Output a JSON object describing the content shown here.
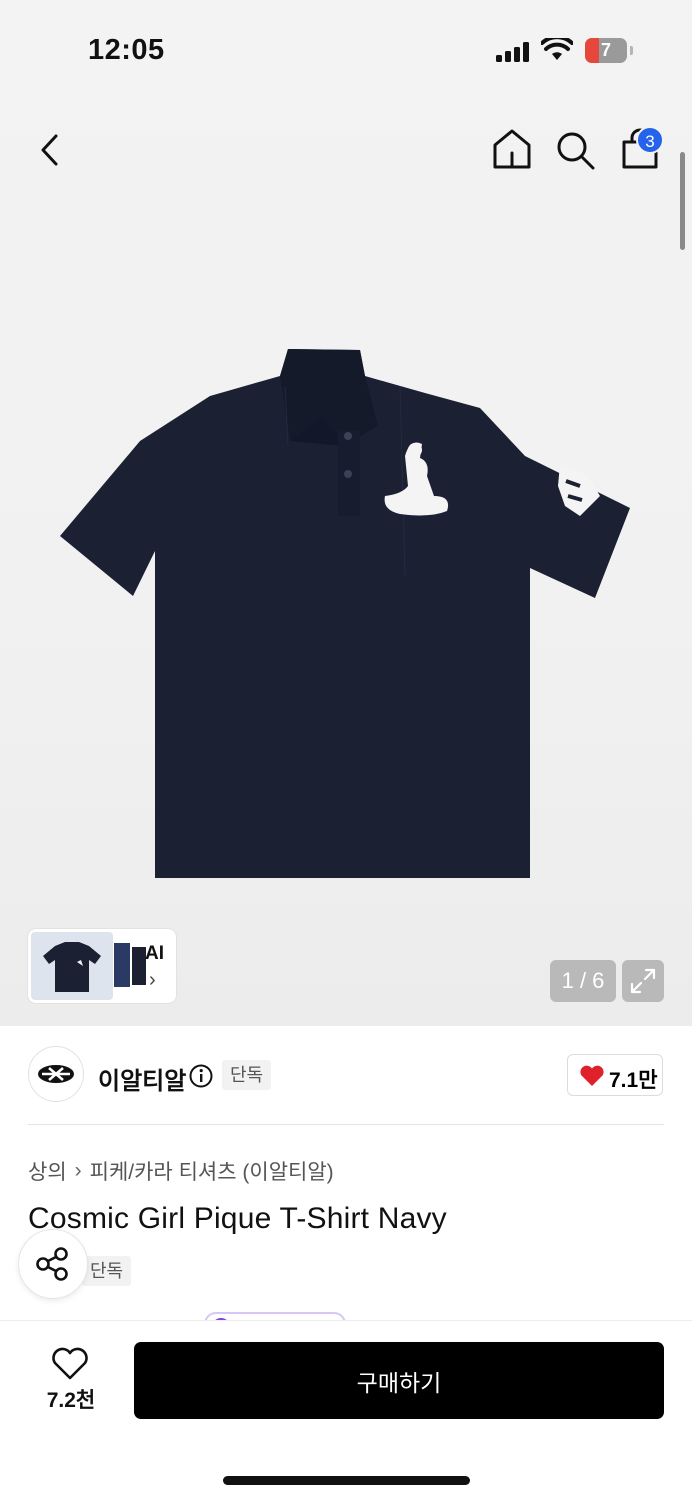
{
  "status_bar": {
    "time": "12:05",
    "battery": "7"
  },
  "header": {
    "back_icon": "chevron-left-icon",
    "home_icon": "home-icon",
    "search_icon": "search-icon",
    "cart_icon": "shopping-bag-icon",
    "cart_count": "3",
    "badge_color": "#2563eb"
  },
  "gallery": {
    "image_subject": "navy pique polo t-shirt",
    "product_color": "#1b2033",
    "thumbnail_label": "AI",
    "counter": "1 / 6",
    "expand_icon": "expand-icon"
  },
  "brand": {
    "name": "이알티알",
    "tag": "단독",
    "like_count": "7.1만",
    "heart_color": "#e0202b"
  },
  "product": {
    "breadcrumb": [
      "상의",
      "피케/카라 티셔츠 (이알티알)"
    ],
    "title": "Cosmic Girl Pique T-Shirt Navy",
    "tag": "단독"
  },
  "bottom_bar": {
    "wish_count": "7.2천",
    "buy_label": "구매하기"
  }
}
